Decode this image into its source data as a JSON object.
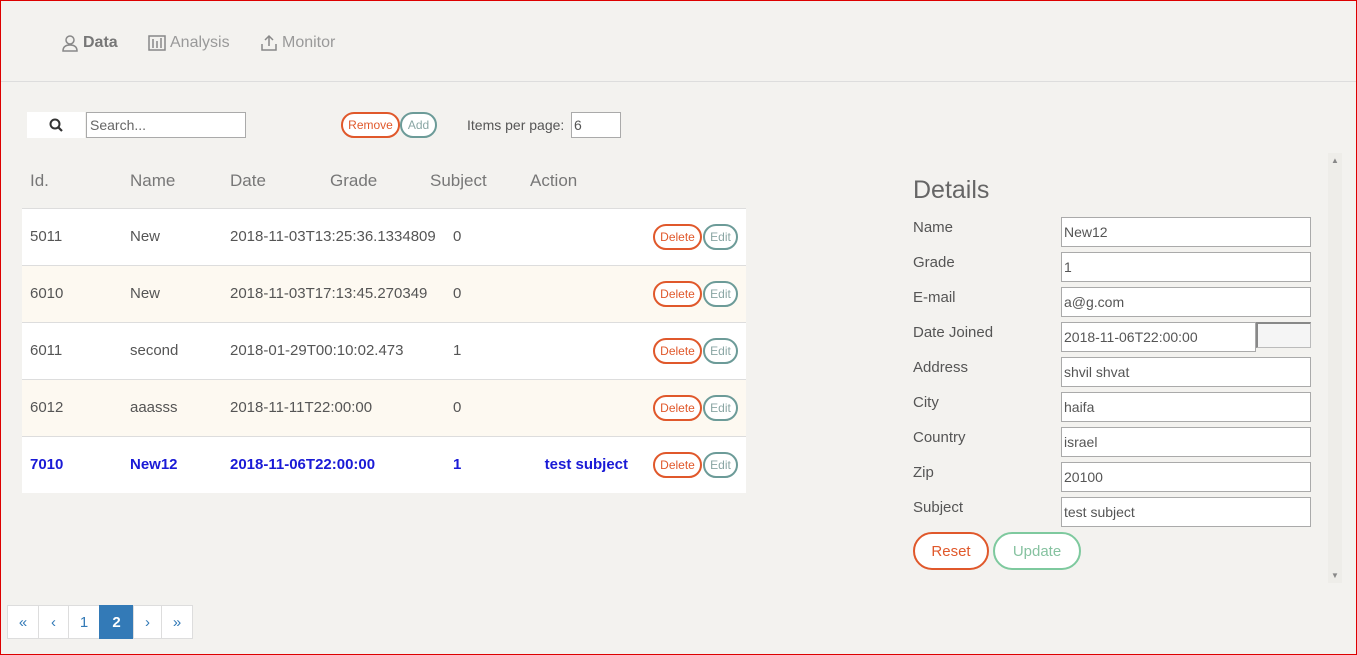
{
  "nav": {
    "data_label": "Data",
    "analysis_label": "Analysis",
    "monitor_label": "Monitor"
  },
  "toolbar": {
    "search_placeholder": "Search...",
    "remove_label": "Remove",
    "add_label": "Add",
    "items_per_page_label": "Items per page:",
    "items_per_page_value": "6"
  },
  "table": {
    "headers": [
      "Id.",
      "Name",
      "Date",
      "Grade",
      "Subject",
      "Action"
    ],
    "delete_label": "Delete",
    "edit_label": "Edit",
    "rows": [
      {
        "id": "5011",
        "name": "New",
        "date": "2018-11-03T13:25:36.1334809",
        "grade": "0",
        "subject": ""
      },
      {
        "id": "6010",
        "name": "New",
        "date": "2018-11-03T17:13:45.270349",
        "grade": "0",
        "subject": ""
      },
      {
        "id": "6011",
        "name": "second",
        "date": "2018-01-29T00:10:02.473",
        "grade": "1",
        "subject": ""
      },
      {
        "id": "6012",
        "name": "aaasss",
        "date": "2018-11-11T22:00:00",
        "grade": "0",
        "subject": ""
      },
      {
        "id": "7010",
        "name": "New12",
        "date": "2018-11-06T22:00:00",
        "grade": "1",
        "subject": "test subject"
      }
    ]
  },
  "details": {
    "title": "Details",
    "labels": {
      "name": "Name",
      "grade": "Grade",
      "email": "E-mail",
      "date_joined": "Date Joined",
      "address": "Address",
      "city": "City",
      "country": "Country",
      "zip": "Zip",
      "subject": "Subject"
    },
    "values": {
      "name": "New12",
      "grade": "1",
      "email": "a@g.com",
      "date_joined": "2018-11-06T22:00:00",
      "address": "shvil shvat",
      "city": "haifa",
      "country": "israel",
      "zip": "20100",
      "subject": "test subject"
    },
    "reset_label": "Reset",
    "update_label": "Update"
  },
  "pagination": {
    "first": "«",
    "prev": "‹",
    "pages": [
      "1",
      "2"
    ],
    "active_page": "2",
    "next": "›",
    "last": "»"
  },
  "colors": {
    "accent_red": "#e0582b",
    "accent_teal": "#6c9b98",
    "accent_green": "#7ec99e",
    "selected_text": "#1a1ad6",
    "pager_blue": "#337ab7"
  }
}
